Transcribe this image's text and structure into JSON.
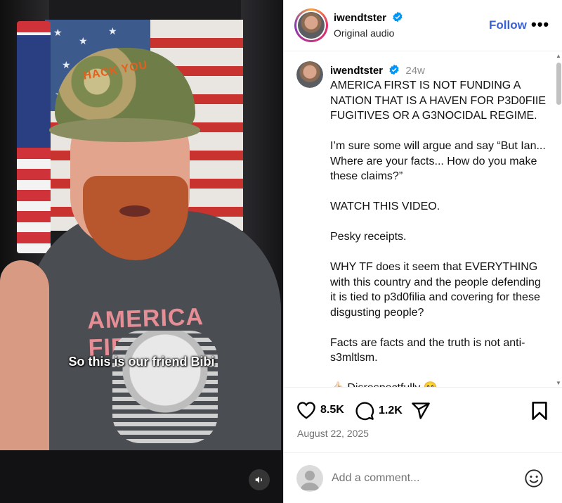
{
  "video": {
    "caption_text": "So this is our friend Bibi",
    "hat_text": "HACK YOU",
    "shirt_text": "AMERICA FIRST"
  },
  "header": {
    "username": "iwendtster",
    "subtitle": "Original audio",
    "follow_label": "Follow",
    "more_label": "•••"
  },
  "post": {
    "username": "iwendtster",
    "time": "24w",
    "paragraphs": [
      "AMERICA FIRST IS NOT FUNDING A NATION THAT IS A HAVEN FOR P3D0FIIE FUGITIVES OR A G3NOCIDAL REGIME.",
      "I’m sure some will argue and say “But Ian... Where are your facts... How do you make these claims?”",
      "WATCH THIS VIDEO.",
      "Pesky receipts.",
      "WHY TF does it seem that EVERYTHING with this country and the people defending it is tied to p3d0filia and covering for these disgusting people?",
      "Facts are facts and the truth is not anti-s3mltlsm.",
      "👍🏻 Disrespectfully 😊"
    ]
  },
  "actions": {
    "likes": "8.5K",
    "comments": "1.2K",
    "date": "August 22, 2025"
  },
  "comment": {
    "placeholder": "Add a comment..."
  },
  "colors": {
    "accent": "#3860d9",
    "verified": "#0095f6",
    "muted": "#737373"
  }
}
